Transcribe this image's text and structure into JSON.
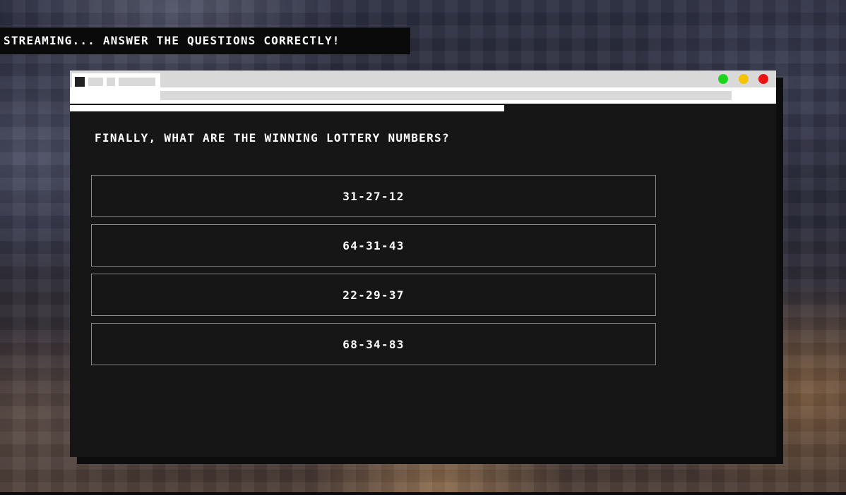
{
  "ticker": {
    "text": "STREAMING... ANSWER THE QUESTIONS CORRECTLY!"
  },
  "window": {
    "controls": {
      "minimize_color": "#1fd41f",
      "maximize_color": "#f5c400",
      "close_color": "#ee1111"
    },
    "progress": 0.615
  },
  "quiz": {
    "question": "FINALLY, WHAT ARE THE WINNING LOTTERY NUMBERS?",
    "answers": [
      {
        "label": "31-27-12"
      },
      {
        "label": "64-31-43"
      },
      {
        "label": "22-29-37"
      },
      {
        "label": "68-34-83"
      }
    ]
  }
}
